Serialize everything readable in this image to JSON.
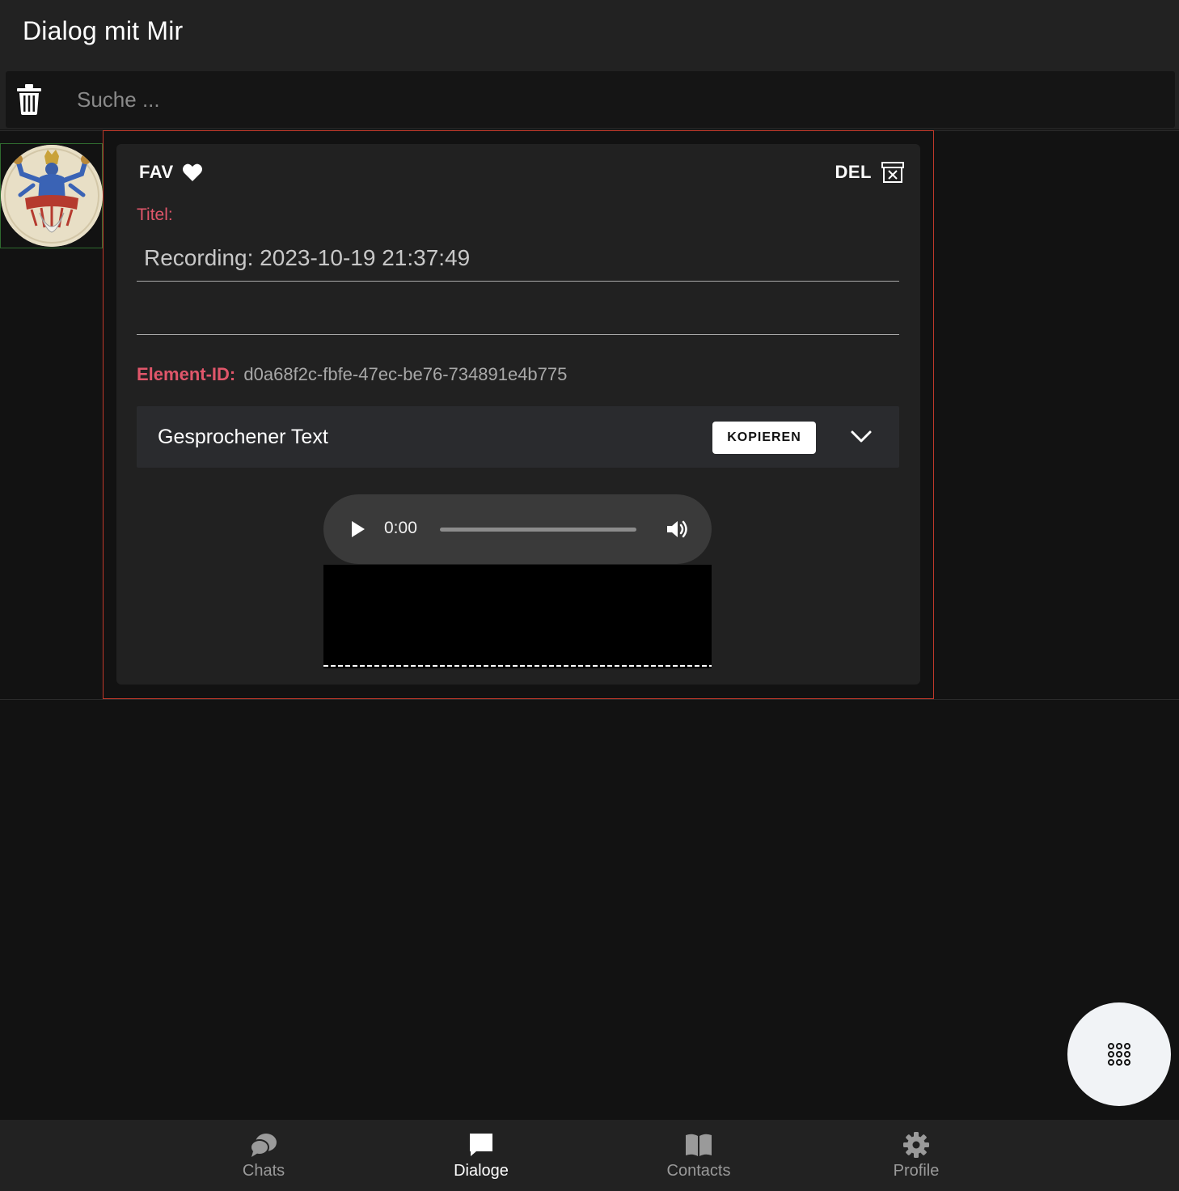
{
  "header": {
    "title": "Dialog mit Mir"
  },
  "search": {
    "placeholder": "Suche ...",
    "value": ""
  },
  "item": {
    "fav_label": "FAV",
    "del_label": "DEL",
    "title_label": "Titel:",
    "title_value": "Recording: 2023-10-19 21:37:49",
    "second_value": "",
    "element_id_label": "Element-ID:",
    "element_id_value": "d0a68f2c-fbfe-47ec-be76-734891e4b775",
    "accordion_title": "Gesprochener Text",
    "copy_label": "KOPIEREN",
    "audio": {
      "time": "0:00",
      "progress": 0
    }
  },
  "nav": {
    "items": [
      {
        "label": "Chats",
        "icon": "chats-icon",
        "active": false
      },
      {
        "label": "Dialoge",
        "icon": "dialoge-icon",
        "active": true
      },
      {
        "label": "Contacts",
        "icon": "contacts-icon",
        "active": false
      },
      {
        "label": "Profile",
        "icon": "profile-icon",
        "active": false
      }
    ]
  },
  "colors": {
    "accent_label": "#e0566a",
    "frame_border": "#c0392b",
    "avatar_border": "#2f6b2f",
    "background": "#121212",
    "surface": "#222222"
  }
}
